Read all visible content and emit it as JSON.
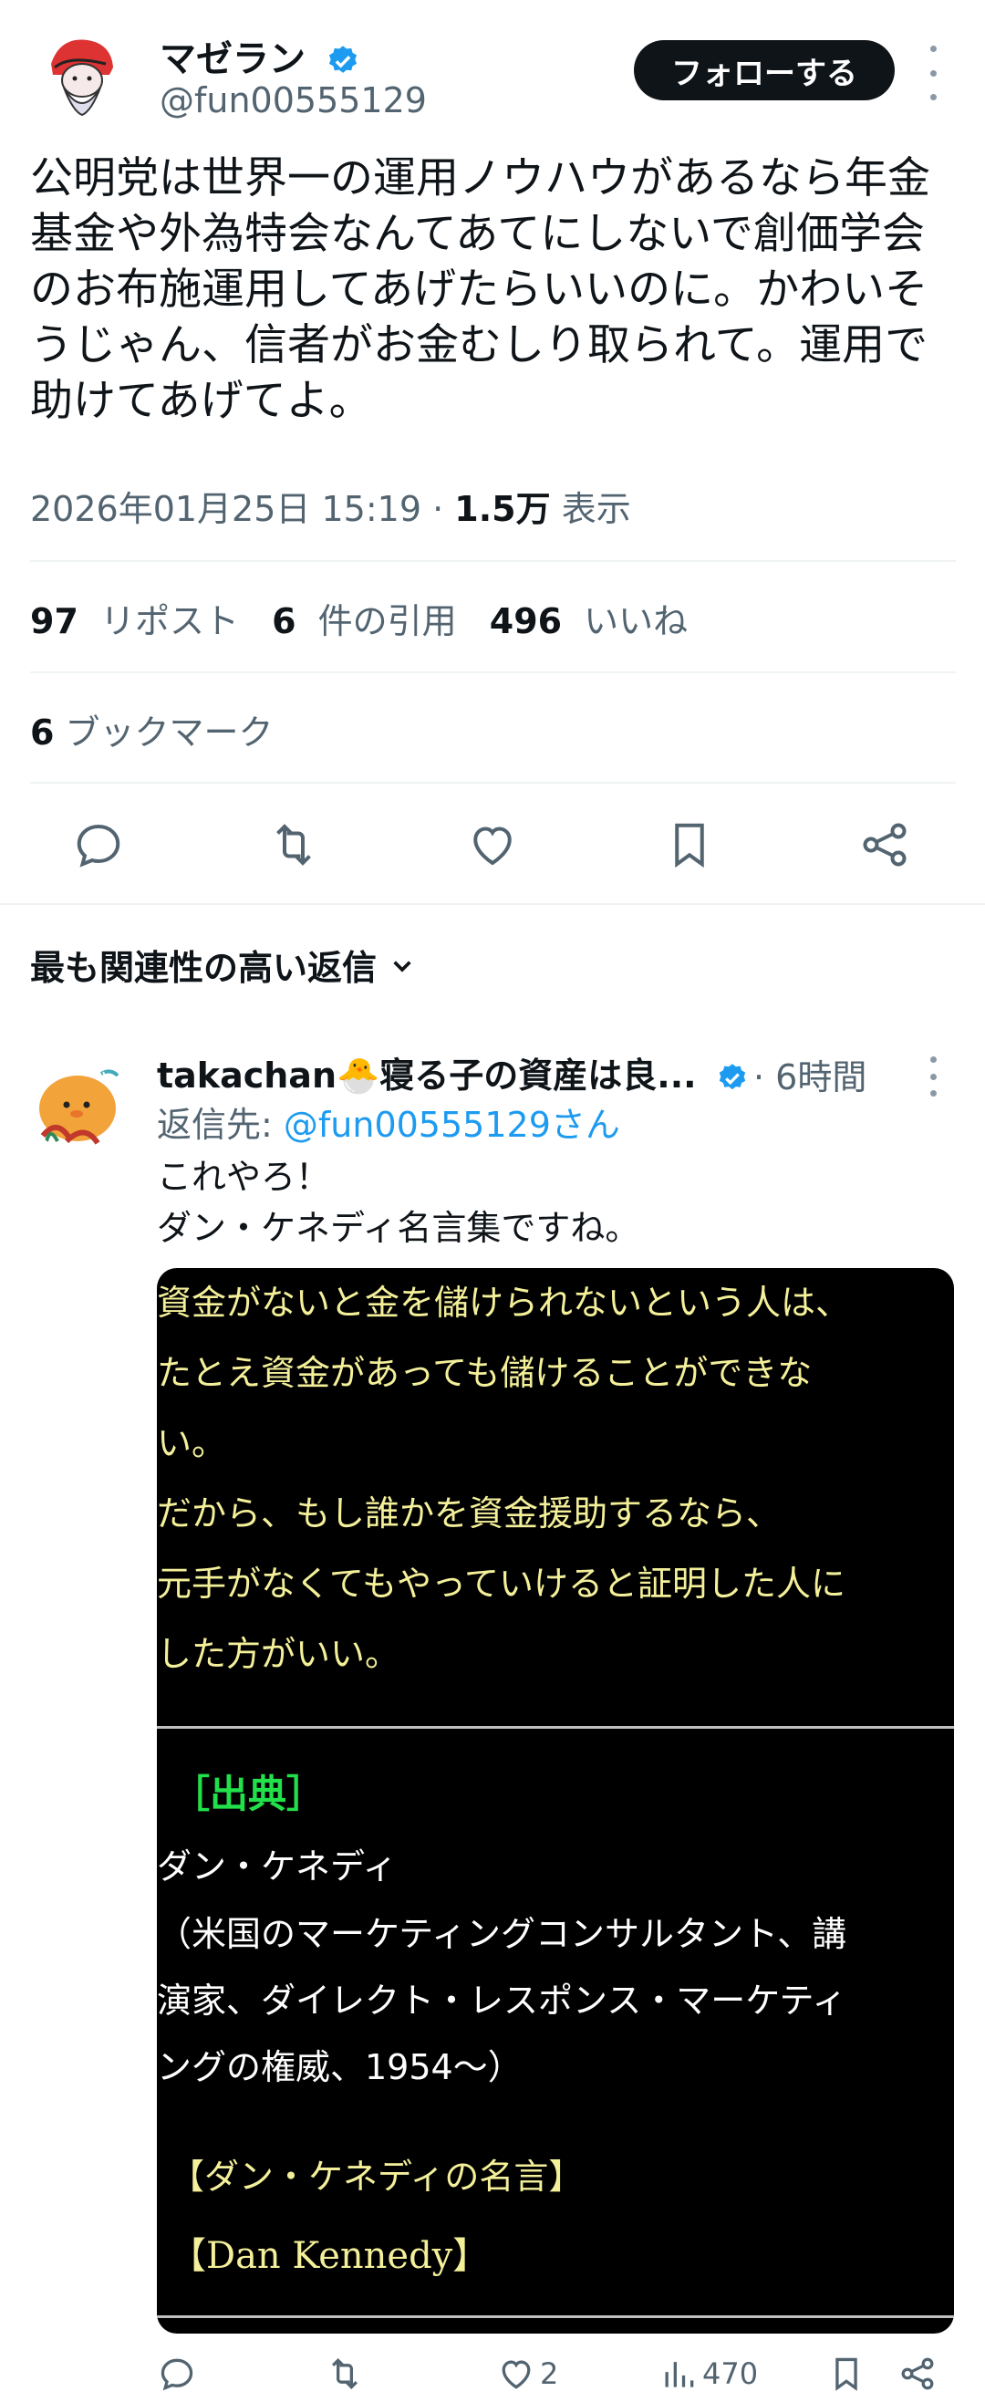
{
  "tweet": {
    "author_name": "マゼラン",
    "handle": "@fun00555129",
    "follow_label": "フォローする",
    "text": "公明党は世界一の運用ノウハウがあるなら年金基金や外為特会なんてあてにしないで創価学会のお布施運用してあげたらいいのに。かわいそうじゃん、信者がお金むしり取られて。運用で助けてあげてよ。",
    "timestamp": "2026年01月25日 15:19",
    "separator": "·",
    "views": "1.5万",
    "views_label": "表示"
  },
  "stats": {
    "reposts": "97",
    "reposts_label": "リポスト",
    "quotes": "6",
    "quotes_label": "件の引用",
    "likes": "496",
    "likes_label": "いいね",
    "bookmarks": "6",
    "bookmarks_label": "ブックマーク"
  },
  "actions": [
    "reply-icon",
    "repost-icon",
    "like-icon",
    "bookmark-icon",
    "share-icon"
  ],
  "replies_header": "最も関連性の高い返信",
  "reply": {
    "author_name": "takachan🐣寝る子の資産は良...",
    "time": "· 6時間",
    "reply_to_label": "返信先:",
    "reply_to_handle": "@fun00555129さん",
    "line1": "これやろ！",
    "line2": "ダン・ケネディ名言集ですね。",
    "quote": {
      "lines": [
        "資金がないと金を儲けられないという人は、",
        "たとえ資金があっても儲けることができな",
        "い。",
        "だから、もし誰かを資金援助するなら、",
        "元手がなくてもやっていけると証明した人に",
        "した方がいい。"
      ],
      "source_heading": "［出典］",
      "source_name": "ダン・ケネディ",
      "source_desc": [
        "（米国のマーケティングコンサルタント、講",
        "演家、ダイレクト・レスポンス・マーケティ",
        "ングの権威、1954〜）"
      ],
      "tag1": "【ダン・ケネディの名言】",
      "tag2": "【Dan Kennedy】"
    },
    "likes": "2",
    "views": "470"
  },
  "colors": {
    "accent": "#1d9bf0",
    "text": "#0f1419",
    "muted": "#536471",
    "quote_yellow": "#f4f09a",
    "quote_green": "#22e04a"
  }
}
